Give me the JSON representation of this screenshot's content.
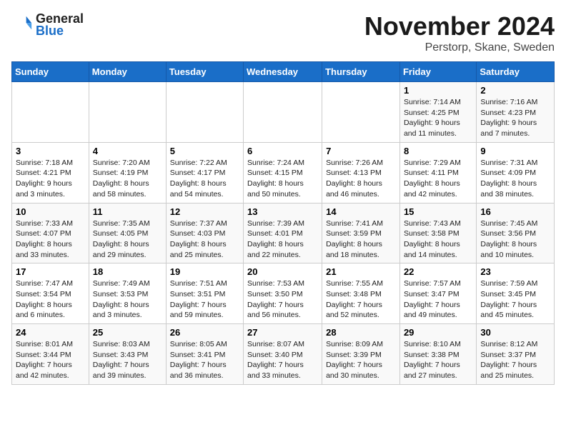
{
  "logo": {
    "line1": "General",
    "line2": "Blue"
  },
  "title": "November 2024",
  "subtitle": "Perstorp, Skane, Sweden",
  "days_header": [
    "Sunday",
    "Monday",
    "Tuesday",
    "Wednesday",
    "Thursday",
    "Friday",
    "Saturday"
  ],
  "weeks": [
    [
      {
        "day": "",
        "info": ""
      },
      {
        "day": "",
        "info": ""
      },
      {
        "day": "",
        "info": ""
      },
      {
        "day": "",
        "info": ""
      },
      {
        "day": "",
        "info": ""
      },
      {
        "day": "1",
        "info": "Sunrise: 7:14 AM\nSunset: 4:25 PM\nDaylight: 9 hours and 11 minutes."
      },
      {
        "day": "2",
        "info": "Sunrise: 7:16 AM\nSunset: 4:23 PM\nDaylight: 9 hours and 7 minutes."
      }
    ],
    [
      {
        "day": "3",
        "info": "Sunrise: 7:18 AM\nSunset: 4:21 PM\nDaylight: 9 hours and 3 minutes."
      },
      {
        "day": "4",
        "info": "Sunrise: 7:20 AM\nSunset: 4:19 PM\nDaylight: 8 hours and 58 minutes."
      },
      {
        "day": "5",
        "info": "Sunrise: 7:22 AM\nSunset: 4:17 PM\nDaylight: 8 hours and 54 minutes."
      },
      {
        "day": "6",
        "info": "Sunrise: 7:24 AM\nSunset: 4:15 PM\nDaylight: 8 hours and 50 minutes."
      },
      {
        "day": "7",
        "info": "Sunrise: 7:26 AM\nSunset: 4:13 PM\nDaylight: 8 hours and 46 minutes."
      },
      {
        "day": "8",
        "info": "Sunrise: 7:29 AM\nSunset: 4:11 PM\nDaylight: 8 hours and 42 minutes."
      },
      {
        "day": "9",
        "info": "Sunrise: 7:31 AM\nSunset: 4:09 PM\nDaylight: 8 hours and 38 minutes."
      }
    ],
    [
      {
        "day": "10",
        "info": "Sunrise: 7:33 AM\nSunset: 4:07 PM\nDaylight: 8 hours and 33 minutes."
      },
      {
        "day": "11",
        "info": "Sunrise: 7:35 AM\nSunset: 4:05 PM\nDaylight: 8 hours and 29 minutes."
      },
      {
        "day": "12",
        "info": "Sunrise: 7:37 AM\nSunset: 4:03 PM\nDaylight: 8 hours and 25 minutes."
      },
      {
        "day": "13",
        "info": "Sunrise: 7:39 AM\nSunset: 4:01 PM\nDaylight: 8 hours and 22 minutes."
      },
      {
        "day": "14",
        "info": "Sunrise: 7:41 AM\nSunset: 3:59 PM\nDaylight: 8 hours and 18 minutes."
      },
      {
        "day": "15",
        "info": "Sunrise: 7:43 AM\nSunset: 3:58 PM\nDaylight: 8 hours and 14 minutes."
      },
      {
        "day": "16",
        "info": "Sunrise: 7:45 AM\nSunset: 3:56 PM\nDaylight: 8 hours and 10 minutes."
      }
    ],
    [
      {
        "day": "17",
        "info": "Sunrise: 7:47 AM\nSunset: 3:54 PM\nDaylight: 8 hours and 6 minutes."
      },
      {
        "day": "18",
        "info": "Sunrise: 7:49 AM\nSunset: 3:53 PM\nDaylight: 8 hours and 3 minutes."
      },
      {
        "day": "19",
        "info": "Sunrise: 7:51 AM\nSunset: 3:51 PM\nDaylight: 7 hours and 59 minutes."
      },
      {
        "day": "20",
        "info": "Sunrise: 7:53 AM\nSunset: 3:50 PM\nDaylight: 7 hours and 56 minutes."
      },
      {
        "day": "21",
        "info": "Sunrise: 7:55 AM\nSunset: 3:48 PM\nDaylight: 7 hours and 52 minutes."
      },
      {
        "day": "22",
        "info": "Sunrise: 7:57 AM\nSunset: 3:47 PM\nDaylight: 7 hours and 49 minutes."
      },
      {
        "day": "23",
        "info": "Sunrise: 7:59 AM\nSunset: 3:45 PM\nDaylight: 7 hours and 45 minutes."
      }
    ],
    [
      {
        "day": "24",
        "info": "Sunrise: 8:01 AM\nSunset: 3:44 PM\nDaylight: 7 hours and 42 minutes."
      },
      {
        "day": "25",
        "info": "Sunrise: 8:03 AM\nSunset: 3:43 PM\nDaylight: 7 hours and 39 minutes."
      },
      {
        "day": "26",
        "info": "Sunrise: 8:05 AM\nSunset: 3:41 PM\nDaylight: 7 hours and 36 minutes."
      },
      {
        "day": "27",
        "info": "Sunrise: 8:07 AM\nSunset: 3:40 PM\nDaylight: 7 hours and 33 minutes."
      },
      {
        "day": "28",
        "info": "Sunrise: 8:09 AM\nSunset: 3:39 PM\nDaylight: 7 hours and 30 minutes."
      },
      {
        "day": "29",
        "info": "Sunrise: 8:10 AM\nSunset: 3:38 PM\nDaylight: 7 hours and 27 minutes."
      },
      {
        "day": "30",
        "info": "Sunrise: 8:12 AM\nSunset: 3:37 PM\nDaylight: 7 hours and 25 minutes."
      }
    ]
  ]
}
